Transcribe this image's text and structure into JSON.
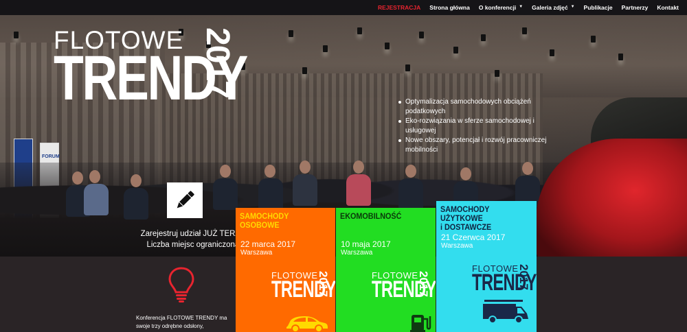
{
  "nav": {
    "items": [
      {
        "label": "REJESTRACJA",
        "active": true,
        "dropdown": false
      },
      {
        "label": "Strona główna",
        "active": false,
        "dropdown": false
      },
      {
        "label": "O konferencji",
        "active": false,
        "dropdown": true
      },
      {
        "label": "Galeria zdjęć",
        "active": false,
        "dropdown": true
      },
      {
        "label": "Publikacje",
        "active": false,
        "dropdown": false
      },
      {
        "label": "Partnerzy",
        "active": false,
        "dropdown": false
      },
      {
        "label": "Kontakt",
        "active": false,
        "dropdown": false
      }
    ]
  },
  "hero": {
    "logo_top": "FLOTOWE",
    "logo_main": "TRENDY",
    "logo_year": "2017",
    "bullets": [
      "Optymalizacja samochodowych obciążeń podatkowych",
      "Eko-rozwiązania w sferze samochodowej i usługowej",
      "Nowe obszary, potencjał i rozwój pracowniczej mobilności"
    ],
    "register_line1": "Zarejestruj udział JUŻ TERAZ!",
    "register_line2": "Liczba miejsc ograniczona!",
    "pencil_icon": "pencil-icon",
    "banner_label": "FORUM"
  },
  "about": {
    "bulb_icon": "lightbulb-icon",
    "text_line1": "Konferencja FLOTOWE TRENDY ma",
    "text_line2": "swoje trzy odrębne odsłony,"
  },
  "cards": [
    {
      "title": "SAMOCHODY OSOBOWE",
      "date": "22 marca 2017",
      "city": "Warszawa",
      "logo_top": "FLOTOWE",
      "logo_main": "TRENDY",
      "logo_year": "2017",
      "icon": "car-icon",
      "color": "#ff6a00"
    },
    {
      "title": "EKOMOBILNOŚĆ",
      "date": "10 maja 2017",
      "city": "Warszawa",
      "logo_top": "FLOTOWE",
      "logo_main": "TRENDY",
      "logo_year": "2017",
      "icon": "charging-station-icon",
      "color": "#22dd22"
    },
    {
      "title_line1": "SAMOCHODY UŻYTKOWE",
      "title_line2": "i DOSTAWCZE",
      "date": "21 Czerwca 2017",
      "city": "Warszawa",
      "logo_top": "FLOTOWE",
      "logo_main": "TRENDY",
      "logo_year": "2017",
      "icon": "van-icon",
      "color": "#33ddee"
    }
  ],
  "colors": {
    "nav_active": "#e8242f",
    "background": "#2a2426",
    "bulb": "#e8242f"
  }
}
